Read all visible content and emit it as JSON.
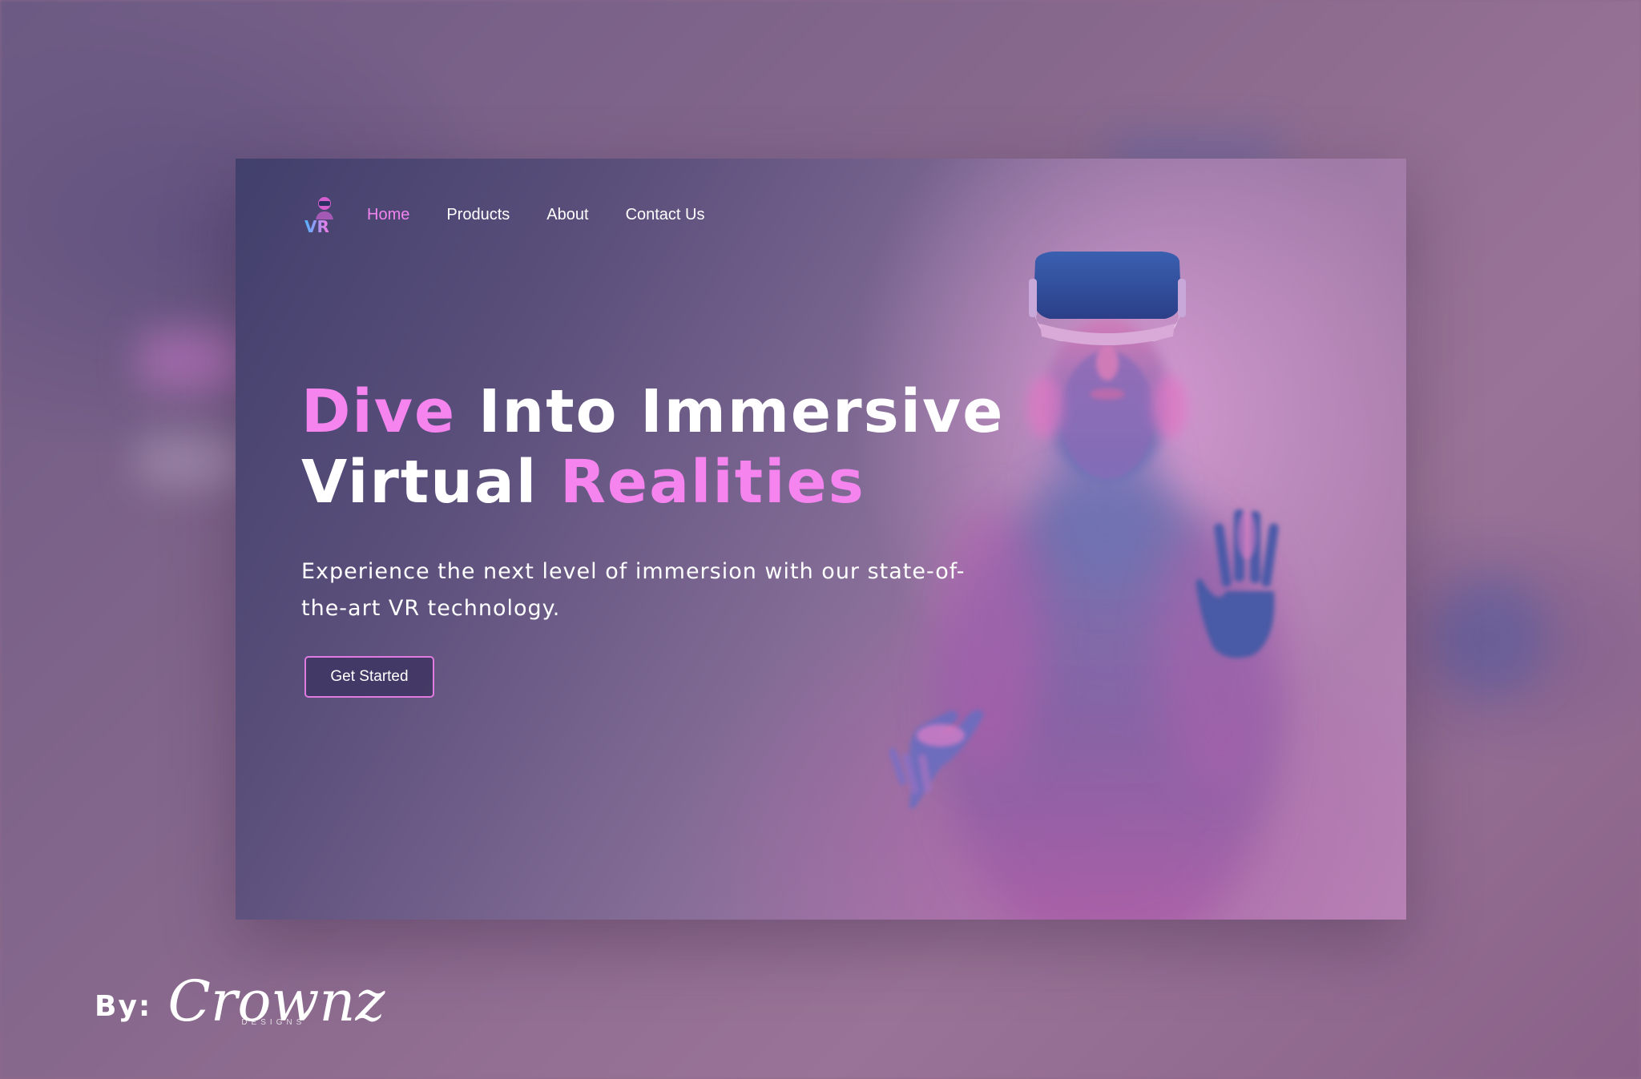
{
  "nav": {
    "logo_text": "VR",
    "items": [
      {
        "label": "Home",
        "active": true
      },
      {
        "label": "Products",
        "active": false
      },
      {
        "label": "About",
        "active": false
      },
      {
        "label": "Contact Us",
        "active": false
      }
    ]
  },
  "hero": {
    "headline_line1_accent": "Dive",
    "headline_line1_rest": " Into Immersive",
    "headline_line2_start": "Virtual ",
    "headline_line2_accent": "Realities",
    "subtext": "Experience the next level of immersion with our state-of-the-art VR technology.",
    "cta_label": "Get Started"
  },
  "credit": {
    "by_label": "By:",
    "signature": "Crownz",
    "sub": "DESIGNS"
  },
  "colors": {
    "accent_pink": "#f584ef",
    "text_white": "#ffffff",
    "button_bg": "#413764",
    "headset_blue": "#2f4f9a"
  }
}
